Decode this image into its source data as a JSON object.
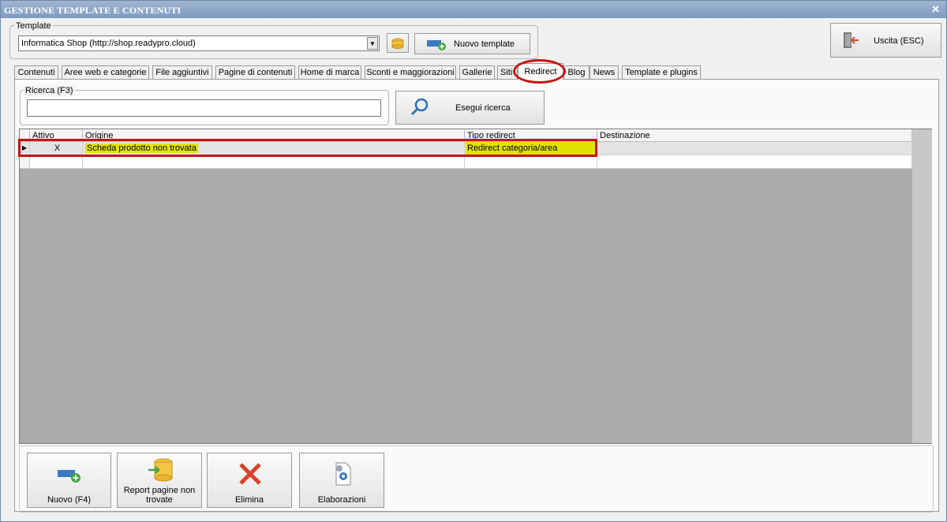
{
  "window": {
    "title": "GESTIONE TEMPLATE E CONTENUTI",
    "close": "✕"
  },
  "template": {
    "group_label": "Template",
    "selected": "Informatica Shop (http://shop.readypro.cloud)",
    "new_label": "Nuovo template"
  },
  "exit_label": "Uscita (ESC)",
  "tabs": [
    "Contenuti",
    "Aree web e categorie",
    "File aggiuntivi",
    "Pagine di contenuti",
    "Home di marca",
    "Sconti e maggiorazioni",
    "Gallerie",
    "Siti",
    "Redirect",
    "Blog",
    "News",
    "Template e plugins"
  ],
  "active_tab": "Redirect",
  "search": {
    "group_label": "Ricerca (F3)",
    "value": "",
    "button_label": "Esegui ricerca"
  },
  "grid": {
    "columns": [
      "Attivo",
      "Origine",
      "Tipo redirect",
      "Destinazione"
    ],
    "rows": [
      {
        "attivo": "X",
        "origine": "Scheda prodotto non trovata",
        "tipo": "Redirect categoria/area",
        "destinazione": ""
      }
    ]
  },
  "actions": {
    "new": "Nuovo (F4)",
    "report_1": "Report pagine non",
    "report_2": "trovate",
    "delete": "Elimina",
    "processing": "Elaborazioni"
  },
  "colors": {
    "highlight": "#e2e200",
    "annotation": "#c81414",
    "titlebar": "#8aa4c8"
  },
  "icons": [
    "exit-door-icon",
    "folder-icon",
    "add-template-icon",
    "search-icon",
    "new-record-icon",
    "database-report-icon",
    "delete-x-icon",
    "gear-document-icon",
    "row-pointer-icon",
    "dropdown-arrow-icon"
  ]
}
